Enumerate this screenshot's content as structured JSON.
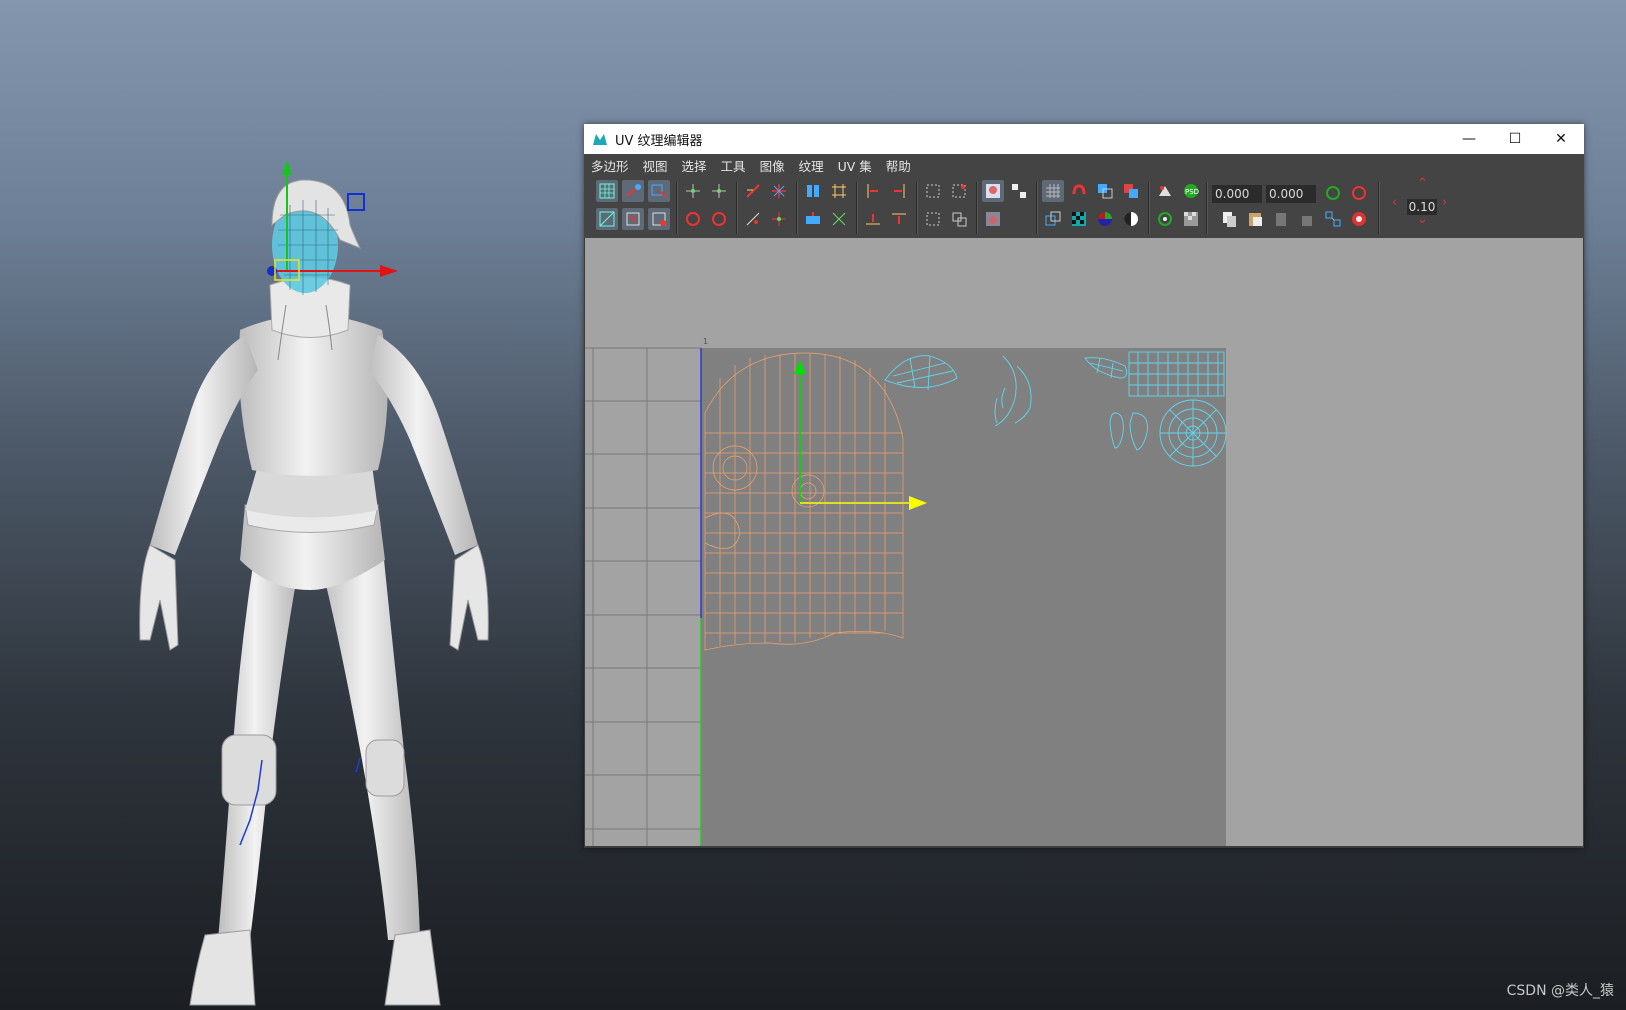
{
  "uv_window": {
    "title": "UV 纹理编辑器",
    "controls": {
      "minimize": "—",
      "maximize": "☐",
      "close": "✕"
    },
    "menu": [
      "多边形",
      "视图",
      "选择",
      "工具",
      "图像",
      "纹理",
      "UV 集",
      "帮助"
    ],
    "fields": {
      "u_value": "0.000",
      "v_value": "0.000",
      "zoom": "0.10"
    },
    "grid_label": "1",
    "accent_colors": {
      "uv_shells_selected": "#f0a36c",
      "uv_shells": "#5fd6ee",
      "move_x": "#ffff00",
      "move_y": "#00dd00"
    }
  },
  "viewport": {
    "character": "character-model-white-outfit",
    "gizmo_colors": {
      "x": "#e01414",
      "y": "#17c41f",
      "z": "#1530c9"
    }
  },
  "watermark": "CSDN @类人_猿"
}
